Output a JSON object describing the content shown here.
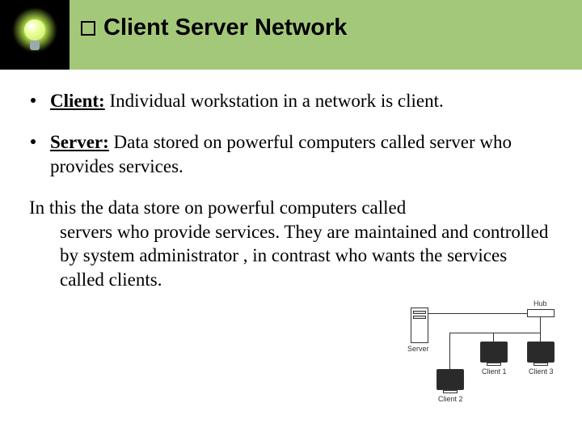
{
  "header": {
    "title": "Client Server Network"
  },
  "bullets": [
    {
      "term": "Client:",
      "text": " Individual workstation in a network is client."
    },
    {
      "term": "Server:",
      "text": " Data stored on powerful computers called server who provides services."
    }
  ],
  "paragraph": {
    "line1": "In this the data store on powerful computers called",
    "rest": "servers who provide services. They are maintained and controlled by system administrator , in contrast who wants the services called clients."
  },
  "diagram": {
    "server": "Server",
    "hub": "Hub",
    "client1": "Client 1",
    "client2": "Client 2",
    "client3": "Client 3"
  }
}
